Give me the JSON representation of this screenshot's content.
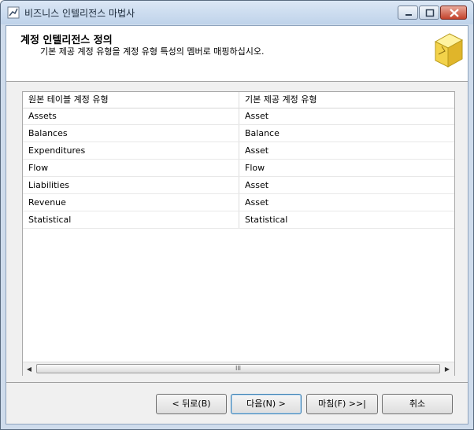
{
  "window": {
    "title": "비즈니스 인텔리전스 마법사"
  },
  "header": {
    "title": "계정 인텔리전스 정의",
    "subtitle": "기본 제공 계정 유형을 계정 유형 특성의 멤버로 매핑하십시오."
  },
  "grid": {
    "columns": [
      "원본 테이블 계정 유형",
      "기본 제공 계정 유형"
    ],
    "rows": [
      [
        "Assets",
        "Asset"
      ],
      [
        "Balances",
        "Balance"
      ],
      [
        "Expenditures",
        "Asset"
      ],
      [
        "Flow",
        "Flow"
      ],
      [
        "Liabilities",
        "Asset"
      ],
      [
        "Revenue",
        "Asset"
      ],
      [
        "Statistical",
        "Statistical"
      ]
    ],
    "scrollbar_thumb": "III"
  },
  "buttons": {
    "back": "< 뒤로(B)",
    "next": "다음(N) >",
    "finish": "마침(F) >>|",
    "cancel": "취소"
  }
}
